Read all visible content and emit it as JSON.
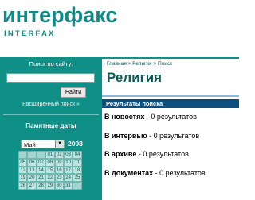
{
  "logo": {
    "main": "интерфакс",
    "sub": "INTERFAX"
  },
  "search": {
    "label": "Поиск по сайту:",
    "input_value": "",
    "button_label": "Найти",
    "advanced_link": "Расширенный поиск »"
  },
  "dates": {
    "title": "Памятные даты",
    "month": "Май",
    "year": "2008",
    "rows": [
      [
        "",
        "",
        "",
        "01",
        "02",
        "03",
        "04"
      ],
      [
        "05",
        "06",
        "07",
        "08",
        "09",
        "10",
        "11"
      ],
      [
        "12",
        "13",
        "14",
        "15",
        "16",
        "17",
        "18"
      ],
      [
        "19",
        "20",
        "21",
        "22",
        "23",
        "24",
        "25"
      ],
      [
        "26",
        "27",
        "28",
        "29",
        "30",
        "31",
        ""
      ]
    ]
  },
  "breadcrumb": {
    "home": "Главная",
    "sep1": " > ",
    "section": "Религия",
    "sep2": " > ",
    "current": "Поиск"
  },
  "page_title": "Религия",
  "results_title": "Результаты поиска",
  "results": [
    {
      "label": "В новостях",
      "suffix": " - 0 результатов"
    },
    {
      "label": "В интервью",
      "suffix": " - 0 результатов"
    },
    {
      "label": "В архиве",
      "suffix": " - 0 результатов"
    },
    {
      "label": "В документах",
      "suffix": " - 0 результатов"
    }
  ],
  "colors": {
    "teal": "#0f8f86",
    "navy": "#0d4f7c",
    "title": "#0b5e5a"
  }
}
